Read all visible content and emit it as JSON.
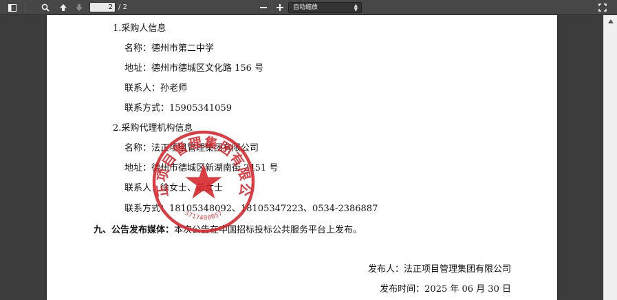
{
  "toolbar": {
    "page_current": "2",
    "page_total": "/ 2",
    "zoom_label": "自动缩放",
    "icons": [
      "sidebar-toggle-icon",
      "search-icon",
      "previous-page-icon",
      "next-page-icon",
      "zoom-out-icon",
      "zoom-in-icon",
      "fullscreen-icon"
    ]
  },
  "document": {
    "purchaser_heading": "1.采购人信息",
    "purchaser_name": "名称：德州市第二中学",
    "purchaser_address": "地址：德州市德城区文化路 156 号",
    "purchaser_contact": "联系人：孙老师",
    "purchaser_phone": "联系方式：15905341059",
    "agency_heading": "2.采购代理机构信息",
    "agency_name": "名称：法正项目管理集团有限公司",
    "agency_address": "地址：德州市德城区新湖南街 2451 号",
    "agency_contact": "联系人：徐女士、范女士",
    "agency_phone": "联系方式：18105348092、18105347223、0534-2386887",
    "section9_label": "九、公告发布媒体：",
    "section9_text": "本次公告在中国招标投标公共服务平台上发布。",
    "publisher": "发布人：法正项目管理集团有限公司",
    "publish_date": "发布时间：2025 年 06 月 30 日"
  },
  "stamp": {
    "ring_text": "法正项目管理集团有限公司",
    "code_text": "3717400057",
    "color": "#d8232a"
  },
  "colors": {
    "toolbar": "#474747",
    "viewer_bg": "#3c3c3c",
    "paper": "#ffffff"
  }
}
